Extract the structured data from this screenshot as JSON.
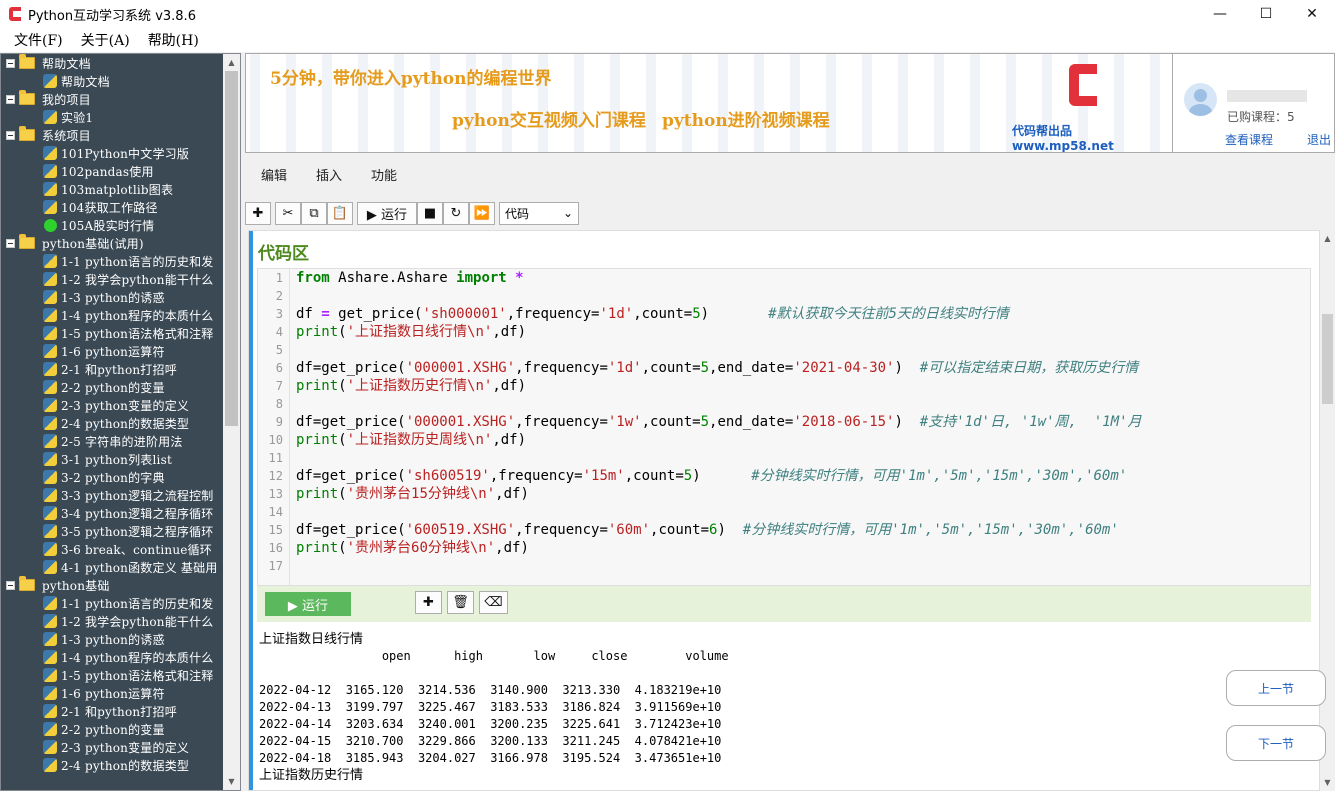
{
  "window": {
    "title": "Python互动学习系统 v3.8.6",
    "controls": [
      "—",
      "☐",
      "✕"
    ]
  },
  "menu": [
    "文件(F)",
    "关于(A)",
    "帮助(H)"
  ],
  "tree": [
    {
      "type": "folder",
      "label": "帮助文档"
    },
    {
      "type": "item",
      "icon": "py",
      "label": "帮助文档"
    },
    {
      "type": "folder",
      "label": "我的项目"
    },
    {
      "type": "item",
      "icon": "py",
      "label": "实验1"
    },
    {
      "type": "folder",
      "label": "系统项目"
    },
    {
      "type": "item",
      "icon": "py",
      "label": "101Python中文学习版"
    },
    {
      "type": "item",
      "icon": "py",
      "label": "102pandas使用"
    },
    {
      "type": "item",
      "icon": "py",
      "label": "103matplotlib图表"
    },
    {
      "type": "item",
      "icon": "py",
      "label": "104获取工作路径"
    },
    {
      "type": "item",
      "icon": "green",
      "label": "105A股实时行情"
    },
    {
      "type": "folder",
      "label": "python基础(试用)"
    },
    {
      "type": "item",
      "icon": "py",
      "label": "1-1 python语言的历史和发"
    },
    {
      "type": "item",
      "icon": "py",
      "label": "1-2 我学会python能干什么"
    },
    {
      "type": "item",
      "icon": "py",
      "label": "1-3 python的诱惑"
    },
    {
      "type": "item",
      "icon": "py",
      "label": "1-4 python程序的本质什么"
    },
    {
      "type": "item",
      "icon": "py",
      "label": "1-5 python语法格式和注释"
    },
    {
      "type": "item",
      "icon": "py",
      "label": "1-6 python运算符"
    },
    {
      "type": "item",
      "icon": "py",
      "label": "2-1 和python打招呼"
    },
    {
      "type": "item",
      "icon": "py",
      "label": "2-2 python的变量"
    },
    {
      "type": "item",
      "icon": "py",
      "label": "2-3 python变量的定义"
    },
    {
      "type": "item",
      "icon": "py",
      "label": "2-4 python的数据类型"
    },
    {
      "type": "item",
      "icon": "py",
      "label": "2-5 字符串的进阶用法"
    },
    {
      "type": "item",
      "icon": "py",
      "label": "3-1 python列表list"
    },
    {
      "type": "item",
      "icon": "py",
      "label": "3-2 python的字典"
    },
    {
      "type": "item",
      "icon": "py",
      "label": "3-3 python逻辑之流程控制"
    },
    {
      "type": "item",
      "icon": "py",
      "label": "3-4 python逻辑之程序循环"
    },
    {
      "type": "item",
      "icon": "py",
      "label": "3-5 python逻辑之程序循环"
    },
    {
      "type": "item",
      "icon": "py",
      "label": "3-6 break、continue循环"
    },
    {
      "type": "item",
      "icon": "py",
      "label": "4-1 python函数定义 基础用"
    },
    {
      "type": "folder",
      "label": "python基础"
    },
    {
      "type": "item",
      "icon": "py",
      "label": "1-1 python语言的历史和发"
    },
    {
      "type": "item",
      "icon": "py",
      "label": "1-2 我学会python能干什么"
    },
    {
      "type": "item",
      "icon": "py",
      "label": "1-3 python的诱惑"
    },
    {
      "type": "item",
      "icon": "py",
      "label": "1-4 python程序的本质什么"
    },
    {
      "type": "item",
      "icon": "py",
      "label": "1-5 python语法格式和注释"
    },
    {
      "type": "item",
      "icon": "py",
      "label": "1-6 python运算符"
    },
    {
      "type": "item",
      "icon": "py",
      "label": "2-1 和python打招呼"
    },
    {
      "type": "item",
      "icon": "py",
      "label": "2-2 python的变量"
    },
    {
      "type": "item",
      "icon": "py",
      "label": "2-3 python变量的定义"
    },
    {
      "type": "item",
      "icon": "py",
      "label": "2-4 python的数据类型"
    }
  ],
  "banner": {
    "headline": "5分钟，带你进入python的编程世界",
    "link1": "pyhon交互视频入门课程",
    "link2": "python进阶视频课程",
    "brand": "代码帮出品 www.mp58.net"
  },
  "user": {
    "purchased": "已购课程：5",
    "view_courses": "查看课程",
    "logout": "退出"
  },
  "tabs": [
    "编辑",
    "插入",
    "功能"
  ],
  "toolbar": {
    "add": "✚",
    "cut": "✂",
    "copy": "⧉",
    "paste": "📋",
    "run": "▶ 运行",
    "stop": "■",
    "restart": "↻",
    "fast_forward": "⏩",
    "cell_type": "代码",
    "cell_type_arrow": "⌄"
  },
  "cell": {
    "title": "代码区",
    "run_label": "▶ 运行",
    "add": "✚",
    "delete": "🗑",
    "clear": "⌫",
    "line_numbers": [
      "1",
      "2",
      "3",
      "4",
      "5",
      "6",
      "7",
      "8",
      "9",
      "10",
      "11",
      "12",
      "13",
      "14",
      "15",
      "16",
      "17"
    ],
    "code": [
      [
        {
          "t": "from",
          "c": "kw"
        },
        {
          "t": " Ashare.Ashare ",
          "c": ""
        },
        {
          "t": "import",
          "c": "kw"
        },
        {
          "t": " ",
          "c": ""
        },
        {
          "t": "*",
          "c": "op"
        }
      ],
      [],
      [
        {
          "t": "df ",
          "c": ""
        },
        {
          "t": "=",
          "c": "op"
        },
        {
          "t": " get_price(",
          "c": ""
        },
        {
          "t": "'sh000001'",
          "c": "str"
        },
        {
          "t": ",frequency=",
          "c": ""
        },
        {
          "t": "'1d'",
          "c": "str"
        },
        {
          "t": ",count=",
          "c": ""
        },
        {
          "t": "5",
          "c": "num"
        },
        {
          "t": ")       ",
          "c": ""
        },
        {
          "t": "#默认获取今天往前5天的日线实时行情",
          "c": "cmt"
        }
      ],
      [
        {
          "t": "print",
          "c": "num"
        },
        {
          "t": "(",
          "c": ""
        },
        {
          "t": "'上证指数日线行情\\n'",
          "c": "str"
        },
        {
          "t": ",df)",
          "c": ""
        }
      ],
      [],
      [
        {
          "t": "df=get_price(",
          "c": ""
        },
        {
          "t": "'000001.XSHG'",
          "c": "str"
        },
        {
          "t": ",frequency=",
          "c": ""
        },
        {
          "t": "'1d'",
          "c": "str"
        },
        {
          "t": ",count=",
          "c": ""
        },
        {
          "t": "5",
          "c": "num"
        },
        {
          "t": ",end_date=",
          "c": ""
        },
        {
          "t": "'2021-04-30'",
          "c": "str"
        },
        {
          "t": ")  ",
          "c": ""
        },
        {
          "t": "#可以指定结束日期，获取历史行情",
          "c": "cmt"
        }
      ],
      [
        {
          "t": "print",
          "c": "num"
        },
        {
          "t": "(",
          "c": ""
        },
        {
          "t": "'上证指数历史行情\\n'",
          "c": "str"
        },
        {
          "t": ",df)",
          "c": ""
        }
      ],
      [],
      [
        {
          "t": "df=get_price(",
          "c": ""
        },
        {
          "t": "'000001.XSHG'",
          "c": "str"
        },
        {
          "t": ",frequency=",
          "c": ""
        },
        {
          "t": "'1w'",
          "c": "str"
        },
        {
          "t": ",count=",
          "c": ""
        },
        {
          "t": "5",
          "c": "num"
        },
        {
          "t": ",end_date=",
          "c": ""
        },
        {
          "t": "'2018-06-15'",
          "c": "str"
        },
        {
          "t": ")  ",
          "c": ""
        },
        {
          "t": "#支持'1d'日, '1w'周,  '1M'月",
          "c": "cmt"
        }
      ],
      [
        {
          "t": "print",
          "c": "num"
        },
        {
          "t": "(",
          "c": ""
        },
        {
          "t": "'上证指数历史周线\\n'",
          "c": "str"
        },
        {
          "t": ",df)",
          "c": ""
        }
      ],
      [],
      [
        {
          "t": "df=get_price(",
          "c": ""
        },
        {
          "t": "'sh600519'",
          "c": "str"
        },
        {
          "t": ",frequency=",
          "c": ""
        },
        {
          "t": "'15m'",
          "c": "str"
        },
        {
          "t": ",count=",
          "c": ""
        },
        {
          "t": "5",
          "c": "num"
        },
        {
          "t": ")      ",
          "c": ""
        },
        {
          "t": "#分钟线实时行情，可用'1m','5m','15m','30m','60m'",
          "c": "cmt"
        }
      ],
      [
        {
          "t": "print",
          "c": "num"
        },
        {
          "t": "(",
          "c": ""
        },
        {
          "t": "'贵州茅台15分钟线\\n'",
          "c": "str"
        },
        {
          "t": ",df)",
          "c": ""
        }
      ],
      [],
      [
        {
          "t": "df=get_price(",
          "c": ""
        },
        {
          "t": "'600519.XSHG'",
          "c": "str"
        },
        {
          "t": ",frequency=",
          "c": ""
        },
        {
          "t": "'60m'",
          "c": "str"
        },
        {
          "t": ",count=",
          "c": ""
        },
        {
          "t": "6",
          "c": "num"
        },
        {
          "t": ")  ",
          "c": ""
        },
        {
          "t": "#分钟线实时行情，可用'1m','5m','15m','30m','60m'",
          "c": "cmt"
        }
      ],
      [
        {
          "t": "print",
          "c": "num"
        },
        {
          "t": "(",
          "c": ""
        },
        {
          "t": "'贵州茅台60分钟线\\n'",
          "c": "str"
        },
        {
          "t": ",df)",
          "c": ""
        }
      ],
      []
    ]
  },
  "output": {
    "title1": "上证指数日线行情",
    "header": "                 open      high       low     close        volume",
    "blank": " ",
    "rows": [
      "2022-04-12  3165.120  3214.536  3140.900  3213.330  4.183219e+10",
      "2022-04-13  3199.797  3225.467  3183.533  3186.824  3.911569e+10",
      "2022-04-14  3203.634  3240.001  3200.235  3225.641  3.712423e+10",
      "2022-04-15  3210.700  3229.866  3200.133  3211.245  4.078421e+10",
      "2022-04-18  3185.943  3204.027  3166.978  3195.524  3.473651e+10"
    ],
    "title2": "上证指数历史行情"
  },
  "nav": {
    "prev": "上一节",
    "next": "下一节"
  },
  "scroll": {
    "up": "▲",
    "down": "▼"
  }
}
